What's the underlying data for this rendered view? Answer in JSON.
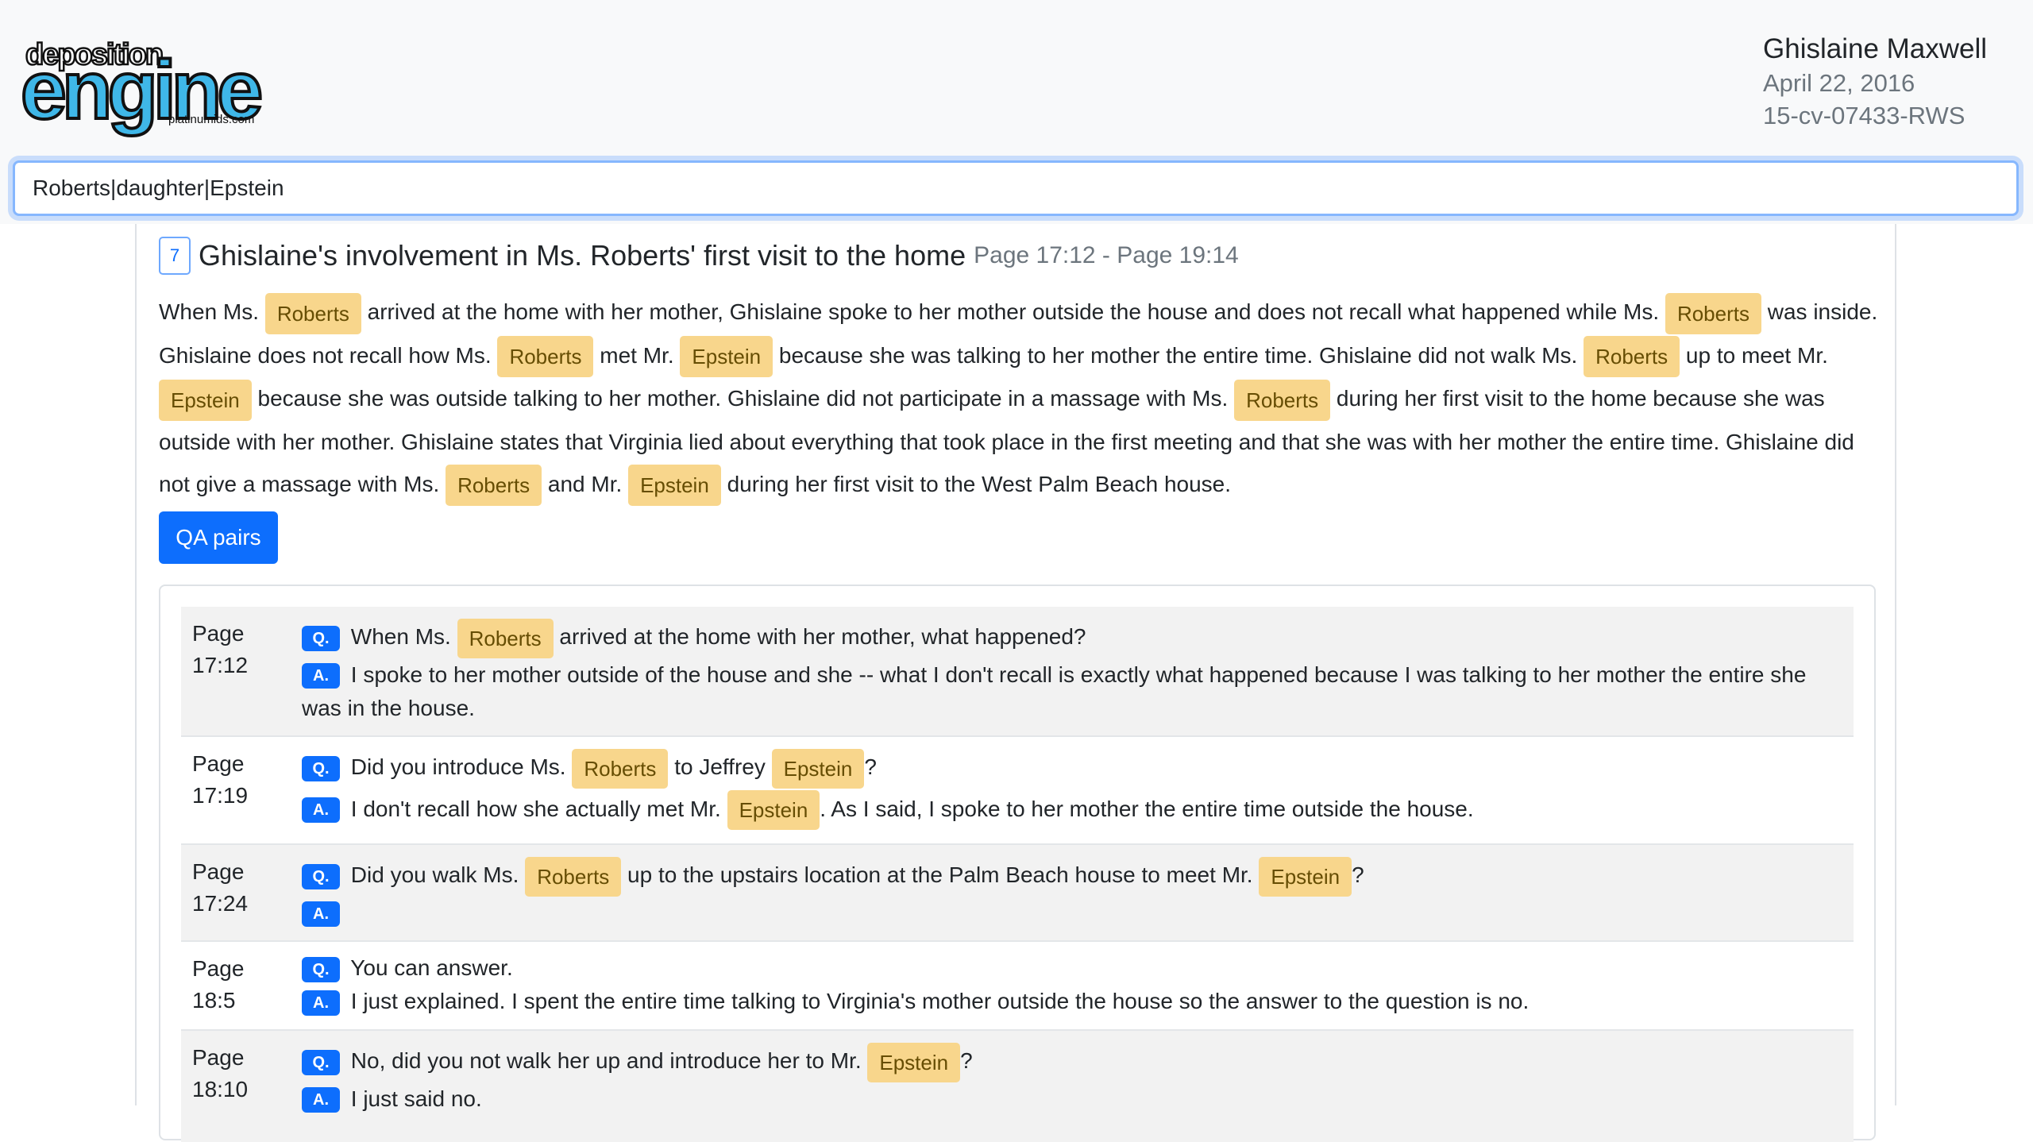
{
  "app": {
    "logo_top": "deposition",
    "logo_main": "engine",
    "logo_sub": "platinumids.com"
  },
  "case": {
    "name": "Ghislaine Maxwell",
    "date": "April 22, 2016",
    "number": "15-cv-07433-RWS"
  },
  "search": {
    "value": "Roberts|daughter|Epstein"
  },
  "section": {
    "number": "7",
    "title": "Ghislaine's involvement in Ms. Roberts' first visit to the home",
    "page_range": "Page 17:12 - Page 19:14",
    "summary": {
      "s1": "When Ms.",
      "h1": "Roberts",
      "s2": "arrived at the home with her mother, Ghislaine spoke to her mother outside the house and does not recall what happened while Ms.",
      "h2": "Roberts",
      "s3": "was inside. Ghislaine does not recall how Ms.",
      "h3": "Roberts",
      "s4": "met Mr.",
      "h4": "Epstein",
      "s5": "because she was talking to her mother the entire time. Ghislaine did not walk Ms.",
      "h5": "Roberts",
      "s6": "up to meet Mr.",
      "h6": "Epstein",
      "s7": "because she was outside talking to her mother. Ghislaine did not participate in a massage with Ms.",
      "h7": "Roberts",
      "s8": "during her first visit to the home because she was outside with her mother. Ghislaine states that Virginia lied about everything that took place in the first meeting and that she was with her mother the entire time. Ghislaine did not give a massage with Ms.",
      "h8": "Roberts",
      "s9": "and Mr.",
      "h9": "Epstein",
      "s10": "during her first visit to the West Palm Beach house."
    },
    "qa_button": "QA pairs"
  },
  "labels": {
    "q": "Q.",
    "a": "A.",
    "page": "Page"
  },
  "qa": [
    {
      "page": "17:12",
      "q": {
        "t1": "When Ms.",
        "h1": "Roberts",
        "t2": "arrived at the home with her mother, what happened?"
      },
      "a": {
        "t1": "I spoke to her mother outside of the house and she -- what I don't recall is exactly what happened because I was talking to her mother the entire she was in the house."
      }
    },
    {
      "page": "17:19",
      "q": {
        "t1": "Did you introduce Ms.",
        "h1": "Roberts",
        "t2": "to Jeffrey",
        "h2": "Epstein",
        "t3": "?"
      },
      "a": {
        "t1": "I don't recall how she actually met Mr.",
        "h1": "Epstein",
        "t2": ". As I said, I spoke to her mother the entire time outside the house."
      }
    },
    {
      "page": "17:24",
      "q": {
        "t1": "Did you walk Ms.",
        "h1": "Roberts",
        "t2": "up to the upstairs location at the Palm Beach house to meet Mr.",
        "h2": "Epstein",
        "t3": "?"
      },
      "a": {
        "t1": ""
      }
    },
    {
      "page": "18:5",
      "q": {
        "t1": "You can answer."
      },
      "a": {
        "t1": "I just explained. I spent the entire time talking to Virginia's mother outside the house so the answer to the question is no."
      }
    },
    {
      "page": "18:10",
      "q": {
        "t1": "No, did you not walk her up and introduce her to Mr.",
        "h1": "Epstein",
        "t2": "?"
      },
      "a": {
        "t1": "I just said no."
      }
    }
  ],
  "colors": {
    "accent": "#0d6efd",
    "highlight": "#f8d68c",
    "highlight_text": "#664d03",
    "row_shade": "#f2f2f2"
  }
}
